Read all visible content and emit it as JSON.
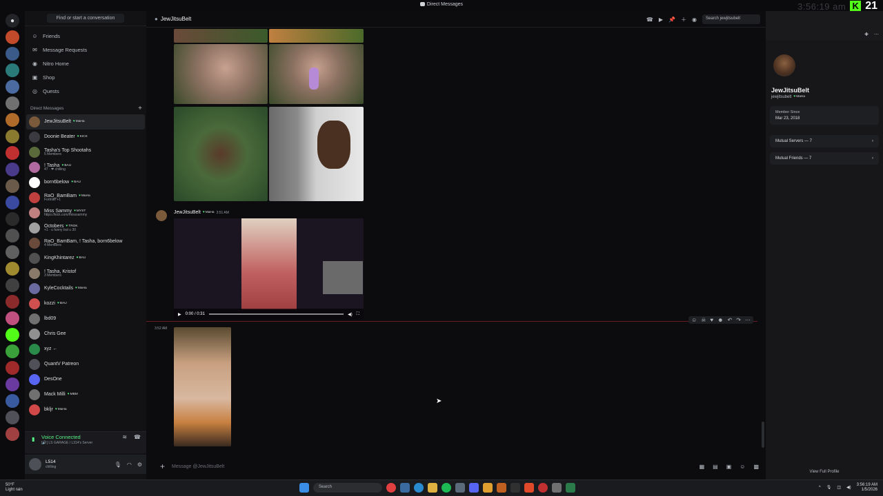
{
  "titlebar": {
    "title": "Direct Messages"
  },
  "overlay": {
    "clock": "3:56:19 am",
    "count": "21"
  },
  "sidebar": {
    "find_placeholder": "Find or start a conversation",
    "nav": [
      {
        "label": "Friends",
        "icon": "friends-icon"
      },
      {
        "label": "Message Requests",
        "icon": "envelope-icon"
      },
      {
        "label": "Nitro Home",
        "icon": "nitro-icon"
      },
      {
        "label": "Shop",
        "icon": "shop-icon"
      },
      {
        "label": "Quests",
        "icon": "quests-icon"
      }
    ],
    "dm_header": "Direct Messages",
    "dms": [
      {
        "name": "JewJitsuBelt",
        "tag": "MaHa",
        "sub": "",
        "color": "#7a5a3a",
        "active": true
      },
      {
        "name": "Doonie Beater",
        "tag": "KICK",
        "sub": "",
        "color": "#3a3a40"
      },
      {
        "name": "Tasha's Top Shootahs",
        "tag": "",
        "sub": "5 Members",
        "color": "#5a6a3a"
      },
      {
        "name": "! Tasha",
        "tag": "BAU",
        "sub": "47 · ❤ chilling",
        "color": "#b06aa0"
      },
      {
        "name": "born6below",
        "tag": "BAU",
        "sub": "",
        "color": "#ffffff"
      },
      {
        "name": "RaO_BamBam",
        "tag": "MaHa",
        "sub": "Fortnite +1",
        "color": "#c04040"
      },
      {
        "name": "Miss Sammy",
        "tag": "MYST",
        "sub": "https://kick.com/misssammy",
        "color": "#c08080"
      },
      {
        "name": "Octobers",
        "tag": "TROK",
        "sub": "+1 · u funny but u 30",
        "color": "#a0a0a0"
      },
      {
        "name": "RaO_BamBam, ! Tasha, born6below",
        "tag": "",
        "sub": "4 Members",
        "color": "#6a4a3a"
      },
      {
        "name": "KingKhintarez",
        "tag": "BAU",
        "sub": "",
        "color": "#505050"
      },
      {
        "name": "! Tasha, Kristof",
        "tag": "",
        "sub": "3 Members",
        "color": "#8a7a6a"
      },
      {
        "name": "KyleCocktails",
        "tag": "MaHa",
        "sub": "",
        "color": "#6a6aa0"
      },
      {
        "name": "kozzi",
        "tag": "BAU",
        "sub": "",
        "color": "#d05050"
      },
      {
        "name": "lbd09",
        "tag": "",
        "sub": "",
        "color": "#707070"
      },
      {
        "name": "Chris Gee",
        "tag": "",
        "sub": "",
        "color": "#909090"
      },
      {
        "name": "xyz ←",
        "tag": "",
        "sub": "",
        "color": "#2a8a4a"
      },
      {
        "name": "QuantV Patreon",
        "tag": "",
        "sub": "",
        "color": "#505058"
      },
      {
        "name": "DesOne",
        "tag": "",
        "sub": "",
        "color": "#5865f2"
      },
      {
        "name": "Mack Milli",
        "tag": "MBM",
        "sub": "",
        "color": "#707070"
      },
      {
        "name": "bkljr",
        "tag": "MaHa",
        "sub": "",
        "color": "#d04848"
      }
    ],
    "voice": {
      "status": "Voice Connected",
      "server": "[🔊] LS GARAGE / L314's Server"
    },
    "user": {
      "name": "L514",
      "status": "chilling"
    }
  },
  "chat": {
    "header_name": "JewJitsuBelt",
    "search_placeholder": "Search jewjitsubelt",
    "message_author": "JewJitsuBelt",
    "message_tag": "MaHa",
    "message_time": "3:51 AM",
    "video_time": "0:00 / 0:31",
    "second_time": "3:52 AM",
    "composer_placeholder": "Message @JewJitsuBelt"
  },
  "profile": {
    "name": "JewJitsuBelt",
    "username": "jewjitsubelt",
    "tag": "MaHa",
    "member_since_label": "Member Since",
    "member_since": "Mar 23, 2018",
    "mutual_servers": "Mutual Servers — 7",
    "mutual_friends": "Mutual Friends — 7",
    "view_full": "View Full Profile"
  },
  "taskbar": {
    "weather_temp": "50°F",
    "weather_desc": "Light rain",
    "search": "Search",
    "time": "3:56:19 AM",
    "date": "1/5/2026"
  }
}
